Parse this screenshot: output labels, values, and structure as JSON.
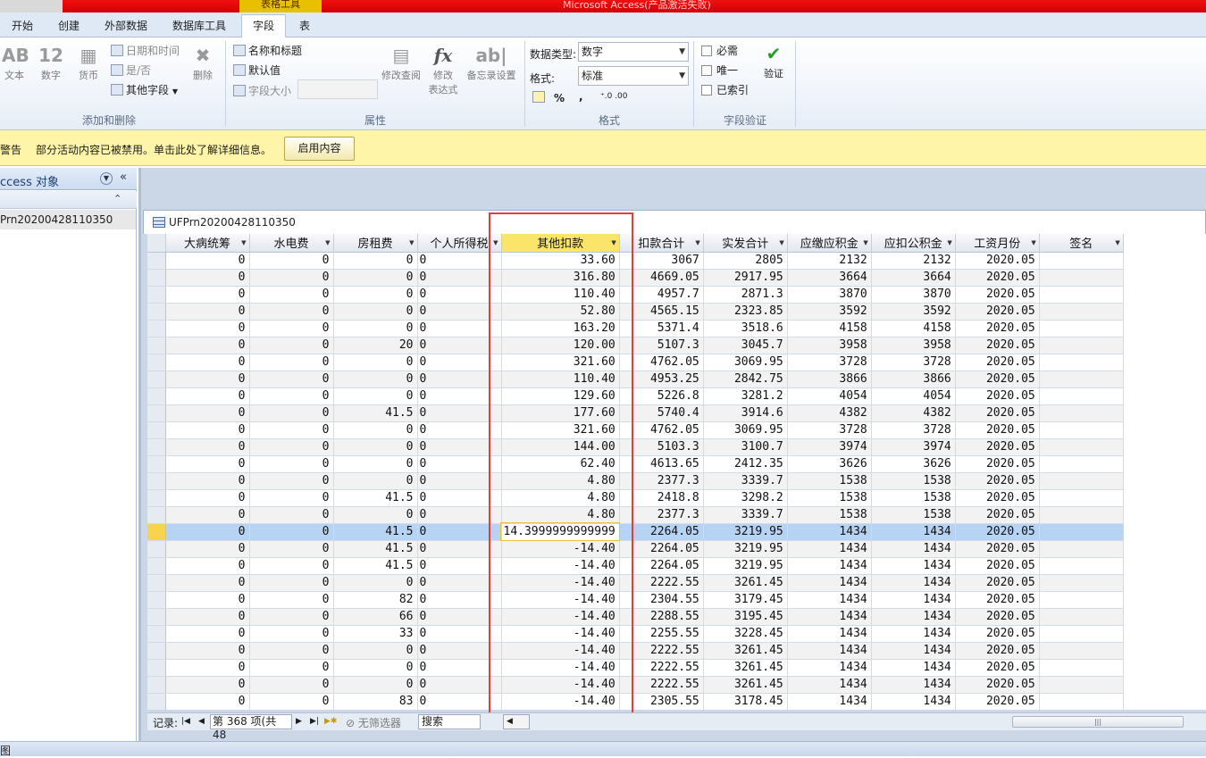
{
  "titlebar": {
    "context_tab": "表格工具",
    "app_title": "Microsoft Access(产品激活失败)"
  },
  "tabs": [
    "开始",
    "创建",
    "外部数据",
    "数据库工具",
    "字段",
    "表"
  ],
  "active_tab": "字段",
  "ribbon": {
    "add_delete": {
      "label": "添加和删除",
      "text": "文本",
      "text_glyph": "AB",
      "number": "数字",
      "number_glyph": "12",
      "currency": "货币",
      "datetime": "日期和时间",
      "yesno": "是/否",
      "more_fields": "其他字段",
      "delete": "删除"
    },
    "properties": {
      "label": "属性",
      "name_caption": "名称和标题",
      "default_value": "默认值",
      "field_size": "字段大小",
      "modify_lookup": "修改查阅",
      "modify_expr_1": "修改",
      "modify_expr_2": "表达式",
      "memo_settings": "备忘录设置"
    },
    "formatting": {
      "label": "格式",
      "data_type_label": "数据类型:",
      "data_type_value": "数字",
      "format_label": "格式:",
      "format_value": "标准",
      "percent": "%",
      "comma": ","
    },
    "validation": {
      "label": "字段验证",
      "required": "必需",
      "unique": "唯一",
      "indexed": "已索引",
      "validate": "验证"
    }
  },
  "message_bar": {
    "title": "警告",
    "text": "部分活动内容已被禁用。单击此处了解详细信息。",
    "button": "启用内容"
  },
  "nav_pane": {
    "title": "ccess 对象",
    "item": "Prn20200428110350"
  },
  "document": {
    "tab_title": "UFPrn20200428110350"
  },
  "datasheet": {
    "columns": [
      "大病统筹",
      "水电费",
      "房租费",
      "个人所得税",
      "其他扣款",
      "扣款合计",
      "实发合计",
      "应缴应积金",
      "应扣公积金",
      "工资月份",
      "签名"
    ],
    "selected_column": "其他扣款",
    "current_row_index": 16,
    "editing_value": "14.3999999999999",
    "rows": [
      [
        "0",
        "0",
        "0",
        "0",
        "33.60",
        "3067",
        "2805",
        "2132",
        "2132",
        "2020.05",
        ""
      ],
      [
        "0",
        "0",
        "0",
        "0",
        "316.80",
        "4669.05",
        "2917.95",
        "3664",
        "3664",
        "2020.05",
        ""
      ],
      [
        "0",
        "0",
        "0",
        "0",
        "110.40",
        "4957.7",
        "2871.3",
        "3870",
        "3870",
        "2020.05",
        ""
      ],
      [
        "0",
        "0",
        "0",
        "0",
        "52.80",
        "4565.15",
        "2323.85",
        "3592",
        "3592",
        "2020.05",
        ""
      ],
      [
        "0",
        "0",
        "0",
        "0",
        "163.20",
        "5371.4",
        "3518.6",
        "4158",
        "4158",
        "2020.05",
        ""
      ],
      [
        "0",
        "0",
        "20",
        "0",
        "120.00",
        "5107.3",
        "3045.7",
        "3958",
        "3958",
        "2020.05",
        ""
      ],
      [
        "0",
        "0",
        "0",
        "0",
        "321.60",
        "4762.05",
        "3069.95",
        "3728",
        "3728",
        "2020.05",
        ""
      ],
      [
        "0",
        "0",
        "0",
        "0",
        "110.40",
        "4953.25",
        "2842.75",
        "3866",
        "3866",
        "2020.05",
        ""
      ],
      [
        "0",
        "0",
        "0",
        "0",
        "129.60",
        "5226.8",
        "3281.2",
        "4054",
        "4054",
        "2020.05",
        ""
      ],
      [
        "0",
        "0",
        "41.5",
        "0",
        "177.60",
        "5740.4",
        "3914.6",
        "4382",
        "4382",
        "2020.05",
        ""
      ],
      [
        "0",
        "0",
        "0",
        "0",
        "321.60",
        "4762.05",
        "3069.95",
        "3728",
        "3728",
        "2020.05",
        ""
      ],
      [
        "0",
        "0",
        "0",
        "0",
        "144.00",
        "5103.3",
        "3100.7",
        "3974",
        "3974",
        "2020.05",
        ""
      ],
      [
        "0",
        "0",
        "0",
        "0",
        "62.40",
        "4613.65",
        "2412.35",
        "3626",
        "3626",
        "2020.05",
        ""
      ],
      [
        "0",
        "0",
        "0",
        "0",
        "4.80",
        "2377.3",
        "3339.7",
        "1538",
        "1538",
        "2020.05",
        ""
      ],
      [
        "0",
        "0",
        "41.5",
        "0",
        "4.80",
        "2418.8",
        "3298.2",
        "1538",
        "1538",
        "2020.05",
        ""
      ],
      [
        "0",
        "0",
        "0",
        "0",
        "4.80",
        "2377.3",
        "3339.7",
        "1538",
        "1538",
        "2020.05",
        ""
      ],
      [
        "0",
        "0",
        "41.5",
        "0",
        "14.3999999999999",
        "2264.05",
        "3219.95",
        "1434",
        "1434",
        "2020.05",
        ""
      ],
      [
        "0",
        "0",
        "41.5",
        "0",
        "-14.40",
        "2264.05",
        "3219.95",
        "1434",
        "1434",
        "2020.05",
        ""
      ],
      [
        "0",
        "0",
        "41.5",
        "0",
        "-14.40",
        "2264.05",
        "3219.95",
        "1434",
        "1434",
        "2020.05",
        ""
      ],
      [
        "0",
        "0",
        "0",
        "0",
        "-14.40",
        "2222.55",
        "3261.45",
        "1434",
        "1434",
        "2020.05",
        ""
      ],
      [
        "0",
        "0",
        "82",
        "0",
        "-14.40",
        "2304.55",
        "3179.45",
        "1434",
        "1434",
        "2020.05",
        ""
      ],
      [
        "0",
        "0",
        "66",
        "0",
        "-14.40",
        "2288.55",
        "3195.45",
        "1434",
        "1434",
        "2020.05",
        ""
      ],
      [
        "0",
        "0",
        "33",
        "0",
        "-14.40",
        "2255.55",
        "3228.45",
        "1434",
        "1434",
        "2020.05",
        ""
      ],
      [
        "0",
        "0",
        "0",
        "0",
        "-14.40",
        "2222.55",
        "3261.45",
        "1434",
        "1434",
        "2020.05",
        ""
      ],
      [
        "0",
        "0",
        "0",
        "0",
        "-14.40",
        "2222.55",
        "3261.45",
        "1434",
        "1434",
        "2020.05",
        ""
      ],
      [
        "0",
        "0",
        "0",
        "0",
        "-14.40",
        "2222.55",
        "3261.45",
        "1434",
        "1434",
        "2020.05",
        ""
      ],
      [
        "0",
        "0",
        "83",
        "0",
        "-14.40",
        "2305.55",
        "3178.45",
        "1434",
        "1434",
        "2020.05",
        ""
      ]
    ]
  },
  "record_nav": {
    "label": "记录:",
    "position": "第 368 项(共 48",
    "no_filter": "无筛选器",
    "search": "搜索"
  },
  "statusbar": {
    "text": "图"
  },
  "colors": {
    "titlebar": "#d40000",
    "highlight_box": "#e53c3c",
    "message_bar": "#fff5a8",
    "selected_row": "#b7d3f3",
    "selected_header": "#fbe46a"
  }
}
